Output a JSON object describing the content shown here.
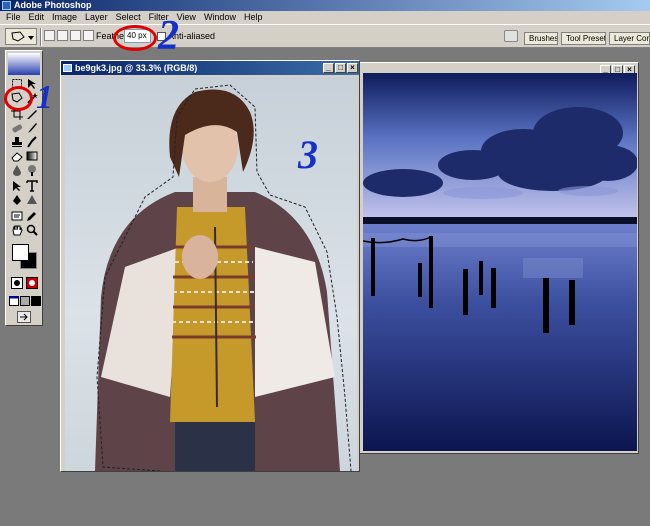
{
  "app": {
    "title": "Adobe Photoshop"
  },
  "menu": [
    "File",
    "Edit",
    "Image",
    "Layer",
    "Select",
    "Filter",
    "View",
    "Window",
    "Help"
  ],
  "options": {
    "feather_label": "Feather:",
    "feather_value": "40 px",
    "antialias_label": "Anti-aliased",
    "palette_tabs": [
      "Brushes",
      "Tool Presets",
      "Layer Comps"
    ]
  },
  "document": {
    "title": "be9gk3.jpg @ 33.3% (RGB/8)"
  },
  "annotations": {
    "one": "1",
    "two": "2",
    "three": "3"
  },
  "colors": {
    "annotation_blue": "#1530c8",
    "annotation_red": "#e00000",
    "workspace": "#7a7a7a"
  }
}
